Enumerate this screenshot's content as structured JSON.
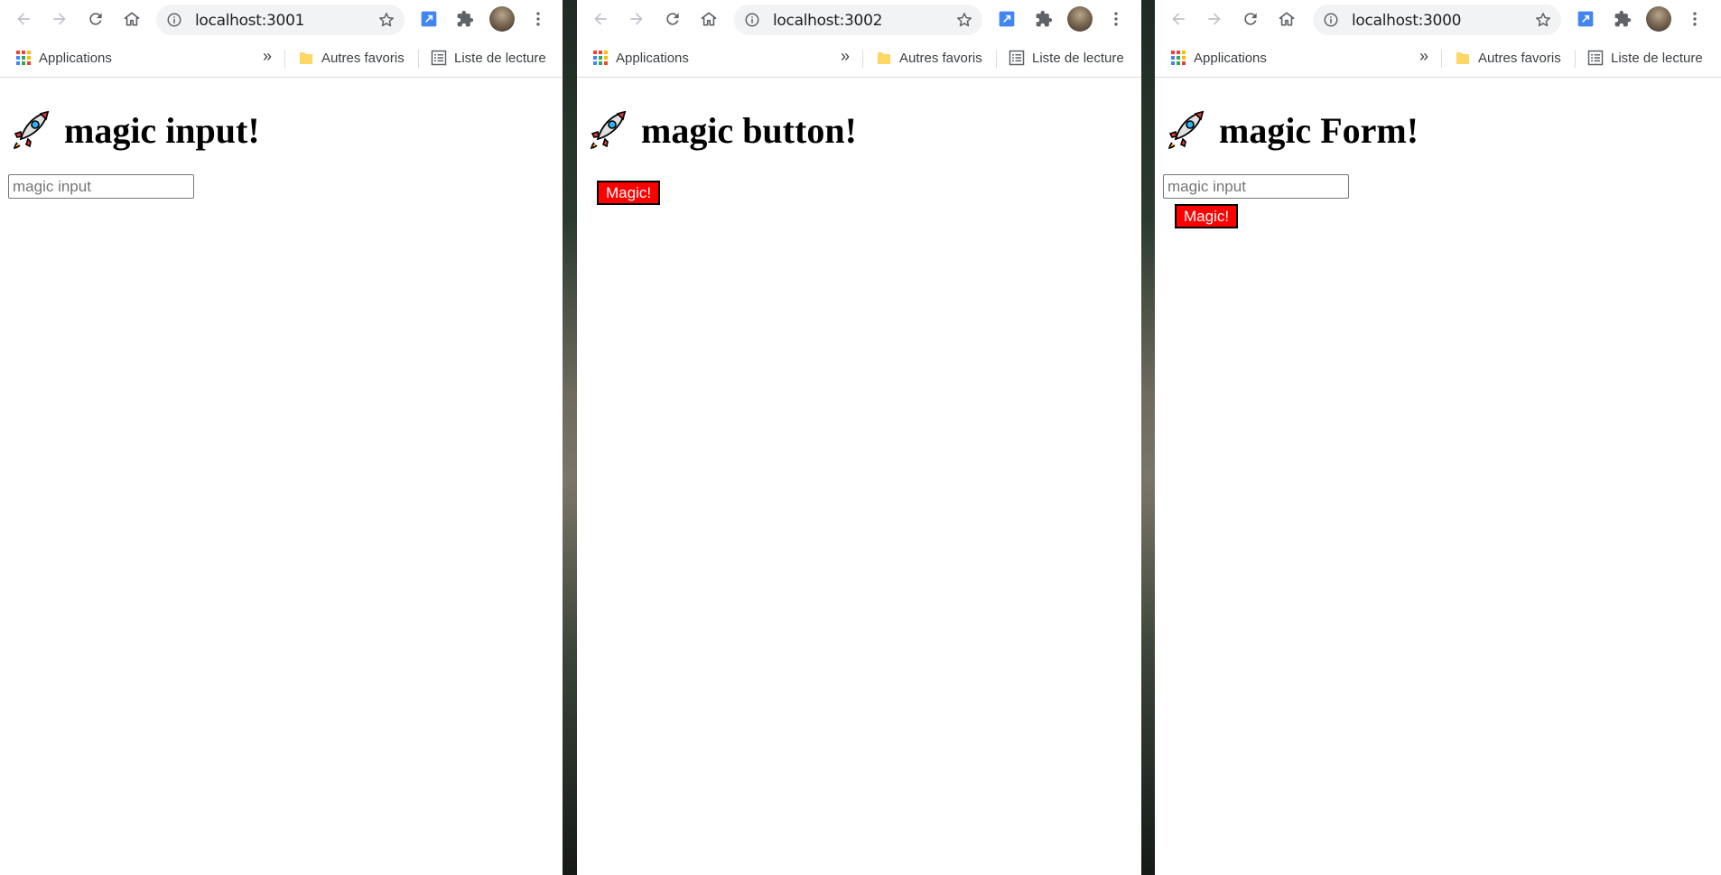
{
  "colors": {
    "accent_button": "#ff0000",
    "button_text": "#ffffff",
    "toolbar_icon": "#5f6368"
  },
  "windows": [
    {
      "url": "localhost:3001",
      "bookmarks": {
        "apps_label": "Applications",
        "more_label": "»",
        "other_label": "Autres favoris",
        "reading_label": "Liste de lecture"
      },
      "page": {
        "title": "magic input!",
        "input_placeholder": "magic input"
      }
    },
    {
      "url": "localhost:3002",
      "bookmarks": {
        "apps_label": "Applications",
        "more_label": "»",
        "other_label": "Autres favoris",
        "reading_label": "Liste de lecture"
      },
      "page": {
        "title": "magic button!",
        "button_label": "Magic!"
      }
    },
    {
      "url": "localhost:3000",
      "bookmarks": {
        "apps_label": "Applications",
        "more_label": "»",
        "other_label": "Autres favoris",
        "reading_label": "Liste de lecture"
      },
      "page": {
        "title": "magic Form!",
        "input_placeholder": "magic input",
        "button_label": "Magic!"
      }
    }
  ]
}
